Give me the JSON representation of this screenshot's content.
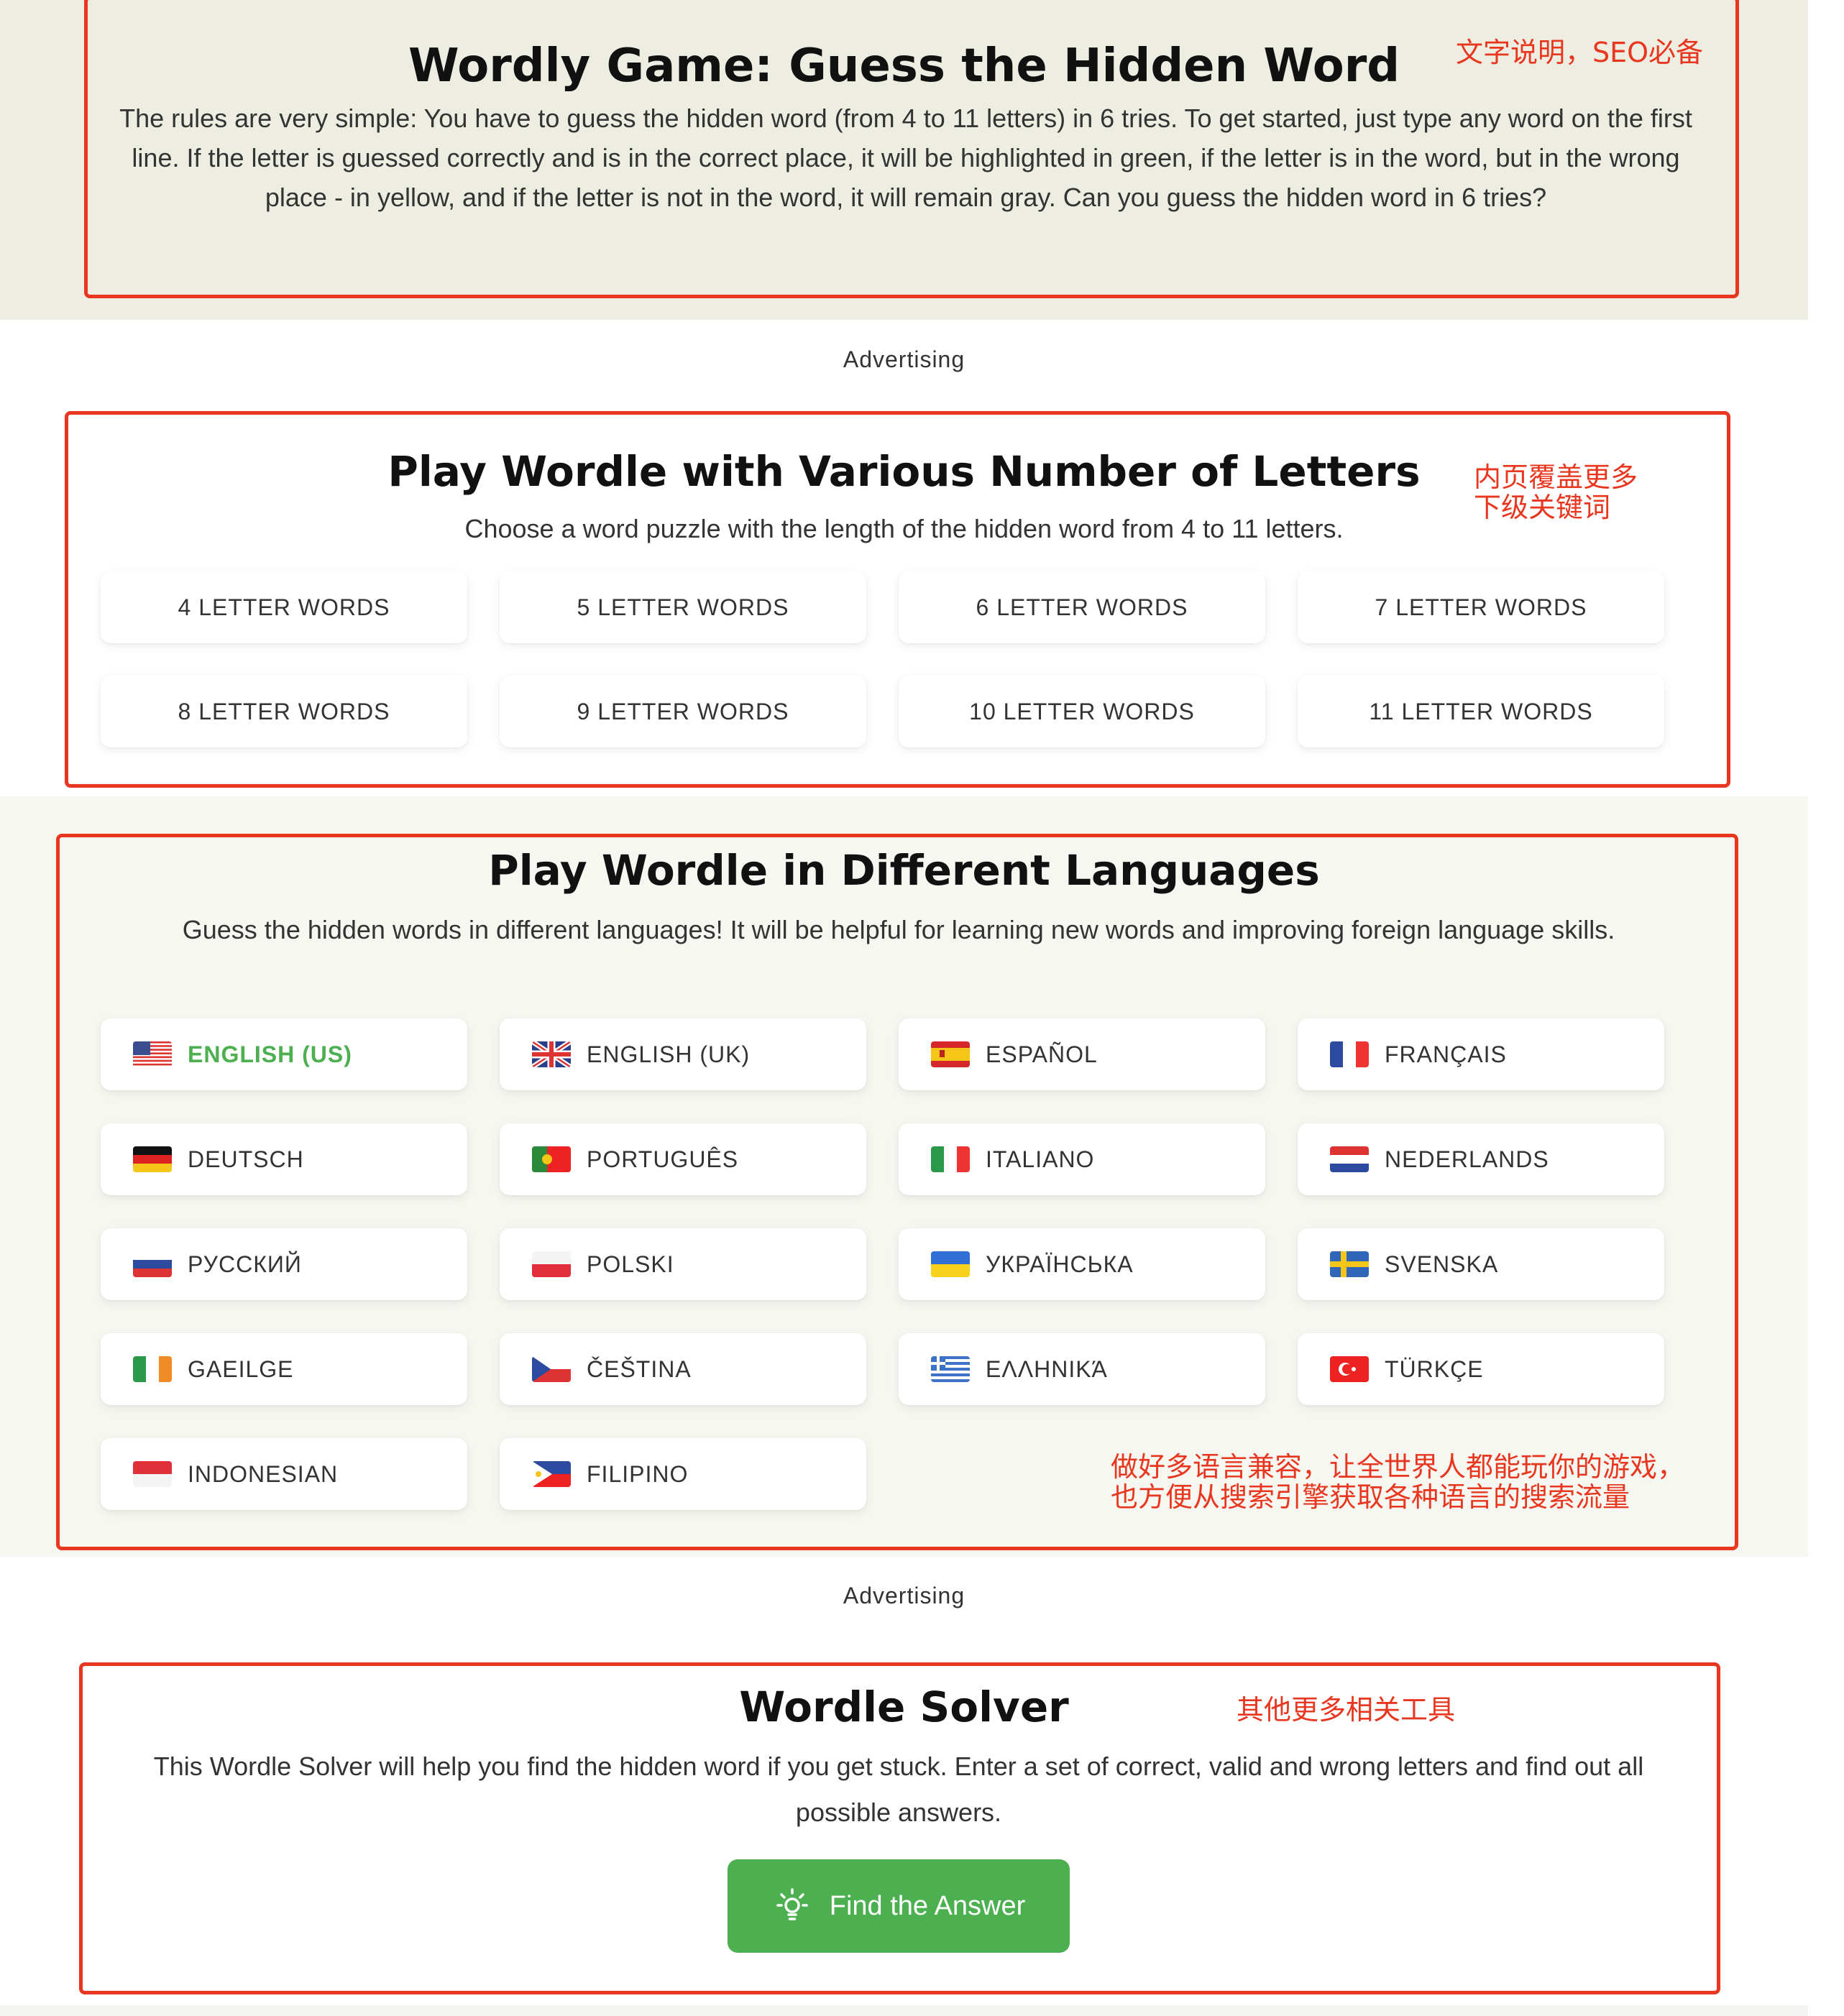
{
  "sections": {
    "intro": {
      "title": "Wordly Game: Guess the Hidden Word",
      "description": "The rules are very simple: You have to guess the hidden word (from 4 to 11 letters) in 6 tries. To get started, just type any word on the first line. If the letter is guessed correctly and is in the correct place, it will be highlighted in green, if the letter is in the word, but in the wrong place - in yellow, and if the letter is not in the word, it will remain gray. Can you guess the hidden word in 6 tries?",
      "note": "文字说明，SEO必备"
    },
    "ad1": "Advertising",
    "letters": {
      "title": "Play Wordle with Various Number of Letters",
      "subtitle": "Choose a word puzzle with the length of the hidden word from 4 to 11 letters.",
      "note_line1": "内页覆盖更多",
      "note_line2": "下级关键词",
      "items": [
        "4 LETTER WORDS",
        "5 LETTER WORDS",
        "6 LETTER WORDS",
        "7 LETTER WORDS",
        "8 LETTER WORDS",
        "9 LETTER WORDS",
        "10 LETTER WORDS",
        "11 LETTER WORDS"
      ]
    },
    "languages": {
      "title": "Play Wordle in Different Languages",
      "subtitle": "Guess the hidden words in different languages! It will be helpful for learning new words and improving foreign language skills.",
      "note_line1": "做好多语言兼容，让全世界人都能玩你的游戏，",
      "note_line2": "也方便从搜索引擎获取各种语言的搜索流量",
      "active_color": "#4caf50",
      "items": [
        {
          "label": "ENGLISH (US)",
          "flag": "us-flag-icon"
        },
        {
          "label": "ENGLISH (UK)",
          "flag": "uk-flag-icon"
        },
        {
          "label": "ESPAÑOL",
          "flag": "spain-flag-icon"
        },
        {
          "label": "FRANÇAIS",
          "flag": "france-flag-icon"
        },
        {
          "label": "DEUTSCH",
          "flag": "germany-flag-icon"
        },
        {
          "label": "PORTUGUÊS",
          "flag": "portugal-flag-icon"
        },
        {
          "label": "ITALIANO",
          "flag": "italy-flag-icon"
        },
        {
          "label": "NEDERLANDS",
          "flag": "netherlands-flag-icon"
        },
        {
          "label": "РУССКИЙ",
          "flag": "russia-flag-icon"
        },
        {
          "label": "POLSKI",
          "flag": "poland-flag-icon"
        },
        {
          "label": "УКРАЇНСЬКА",
          "flag": "ukraine-flag-icon"
        },
        {
          "label": "SVENSKA",
          "flag": "sweden-flag-icon"
        },
        {
          "label": "GAEILGE",
          "flag": "ireland-flag-icon"
        },
        {
          "label": "ČEŠTINA",
          "flag": "czech-flag-icon"
        },
        {
          "label": "ΕΛΛΗΝΙΚΆ",
          "flag": "greece-flag-icon"
        },
        {
          "label": "TÜRKÇE",
          "flag": "turkey-flag-icon"
        },
        {
          "label": "INDONESIAN",
          "flag": "indonesia-flag-icon"
        },
        {
          "label": "FILIPINO",
          "flag": "philippines-flag-icon"
        }
      ]
    },
    "ad2": "Advertising",
    "solver": {
      "title": "Wordle Solver",
      "description": "This Wordle Solver will help you find the hidden word if you get stuck. Enter a set of correct, valid and wrong letters and find out all possible answers.",
      "note": "其他更多相关工具",
      "button_label": "Find the Answer",
      "button_icon": "lightbulb-icon"
    }
  },
  "colors": {
    "annotation_red": "#e8361f",
    "green": "#4caf50"
  }
}
